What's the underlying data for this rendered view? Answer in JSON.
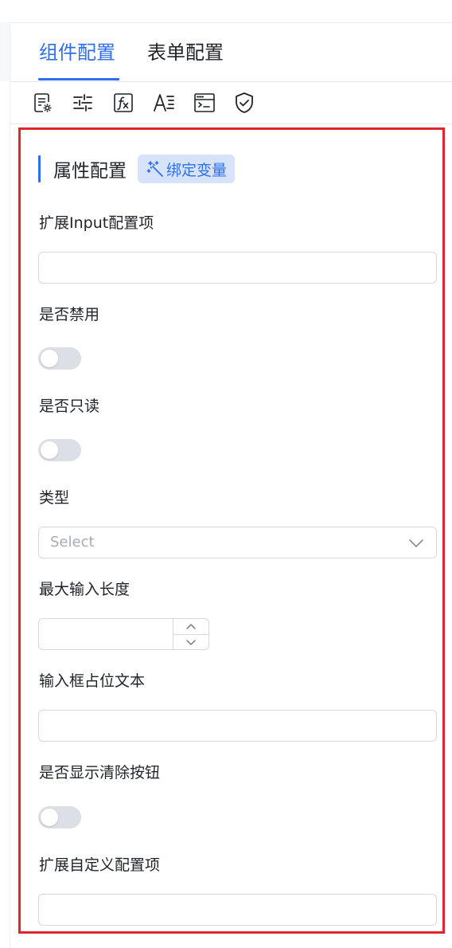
{
  "tabs": [
    {
      "label": "组件配置",
      "active": true
    },
    {
      "label": "表单配置",
      "active": false
    }
  ],
  "toolbar": {
    "icons": [
      "form-settings-icon",
      "sliders-icon",
      "function-icon",
      "text-style-icon",
      "code-window-icon",
      "shield-check-icon"
    ]
  },
  "section": {
    "title": "属性配置",
    "bind_label": "绑定变量"
  },
  "fields": {
    "ext_input": {
      "label": "扩展Input配置项",
      "value": ""
    },
    "disabled": {
      "label": "是否禁用",
      "on": false
    },
    "readonly": {
      "label": "是否只读",
      "on": false
    },
    "type": {
      "label": "类型",
      "placeholder": "Select"
    },
    "maxlength": {
      "label": "最大输入长度",
      "value": ""
    },
    "placeholder_text": {
      "label": "输入框占位文本",
      "value": ""
    },
    "clearable": {
      "label": "是否显示清除按钮",
      "on": false
    },
    "ext_custom": {
      "label": "扩展自定义配置项",
      "value": ""
    }
  },
  "colors": {
    "accent": "#2f6fea",
    "highlight_border": "#e0262a",
    "bind_bg": "#d7e3fb"
  }
}
